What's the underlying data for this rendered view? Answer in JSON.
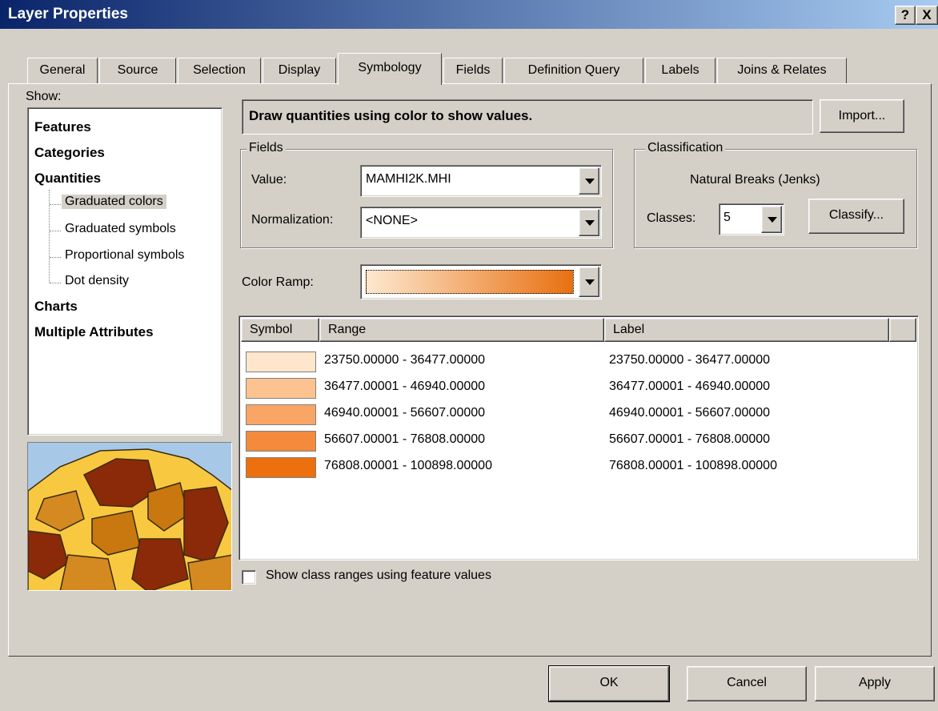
{
  "window": {
    "title": "Layer Properties",
    "help_label": "?",
    "close_label": "X"
  },
  "tabs": [
    {
      "label": "General"
    },
    {
      "label": "Source"
    },
    {
      "label": "Selection"
    },
    {
      "label": "Display"
    },
    {
      "label": "Symbology",
      "active": true
    },
    {
      "label": "Fields"
    },
    {
      "label": "Definition Query"
    },
    {
      "label": "Labels"
    },
    {
      "label": "Joins & Relates"
    }
  ],
  "show": {
    "label": "Show:",
    "items": [
      "Features",
      "Categories",
      "Quantities"
    ],
    "sub_items": [
      "Graduated colors",
      "Graduated symbols",
      "Proportional symbols",
      "Dot density"
    ],
    "items_after": [
      "Charts",
      "Multiple Attributes"
    ],
    "selected": "Graduated colors"
  },
  "description": "Draw quantities using color to show values.",
  "import_label": "Import...",
  "fields": {
    "group_label": "Fields",
    "value_label": "Value:",
    "value": "MAMHI2K.MHI",
    "normalization_label": "Normalization:",
    "normalization": "<NONE>"
  },
  "classification": {
    "group_label": "Classification",
    "method": "Natural Breaks (Jenks)",
    "classes_label": "Classes:",
    "classes": "5",
    "classify_label": "Classify..."
  },
  "color_ramp": {
    "label": "Color Ramp:",
    "start_color": "#fde8d0",
    "end_color": "#e87010"
  },
  "table": {
    "headers": [
      "Symbol",
      "Range",
      "Label"
    ],
    "rows": [
      {
        "color": "#fde6cc",
        "range": "23750.00000 - 36477.00000",
        "label": "23750.00000 - 36477.00000"
      },
      {
        "color": "#fcc390",
        "range": "36477.00001 - 46940.00000",
        "label": "36477.00001 - 46940.00000"
      },
      {
        "color": "#f9a566",
        "range": "46940.00001 - 56607.00000",
        "label": "46940.00001 - 56607.00000"
      },
      {
        "color": "#f48a3c",
        "range": "56607.00001 - 76808.00000",
        "label": "56607.00001 - 76808.00000"
      },
      {
        "color": "#ec700e",
        "range": "76808.00001 - 100898.00000",
        "label": "76808.00001 - 100898.00000"
      }
    ]
  },
  "show_class_ranges_label": "Show class ranges using feature values",
  "buttons": {
    "ok": "OK",
    "cancel": "Cancel",
    "apply": "Apply"
  }
}
